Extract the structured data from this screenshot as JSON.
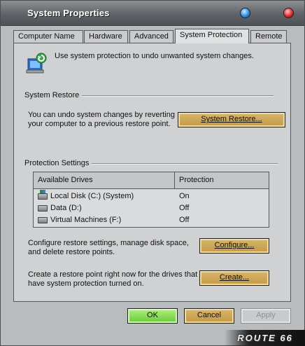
{
  "window": {
    "title": "System Properties",
    "brand": "ROUTE 66"
  },
  "tabs": [
    {
      "label": "Computer Name"
    },
    {
      "label": "Hardware"
    },
    {
      "label": "Advanced"
    },
    {
      "label": "System Protection"
    },
    {
      "label": "Remote"
    }
  ],
  "active_tab": "System Protection",
  "intro": "Use system protection to undo unwanted system changes.",
  "restore": {
    "heading": "System Restore",
    "line1": "You can undo system changes by reverting",
    "line2": "your computer to a previous restore point.",
    "button": "System Restore..."
  },
  "protection": {
    "heading": "Protection Settings",
    "columns": [
      "Available Drives",
      "Protection"
    ],
    "drives": [
      {
        "name": "Local Disk (C:) (System)",
        "protection": "On",
        "icon": "system-drive-icon"
      },
      {
        "name": "Data (D:)",
        "protection": "Off",
        "icon": "drive-icon"
      },
      {
        "name": "Virtual Machines (F:)",
        "protection": "Off",
        "icon": "drive-icon"
      }
    ],
    "configure_line1": "Configure restore settings, manage disk space,",
    "configure_line2": "and delete restore points.",
    "configure_button": "Configure...",
    "create_line1": "Create a restore point right now for the drives that",
    "create_line2": "have system protection turned on.",
    "create_button": "Create..."
  },
  "buttons": {
    "ok": "OK",
    "cancel": "Cancel",
    "apply": "Apply"
  },
  "colors": {
    "accent_button": "#c49a45",
    "ok_button": "#69c93a",
    "help_icon": "#2a8fe0",
    "close_icon": "#e02a2a"
  }
}
